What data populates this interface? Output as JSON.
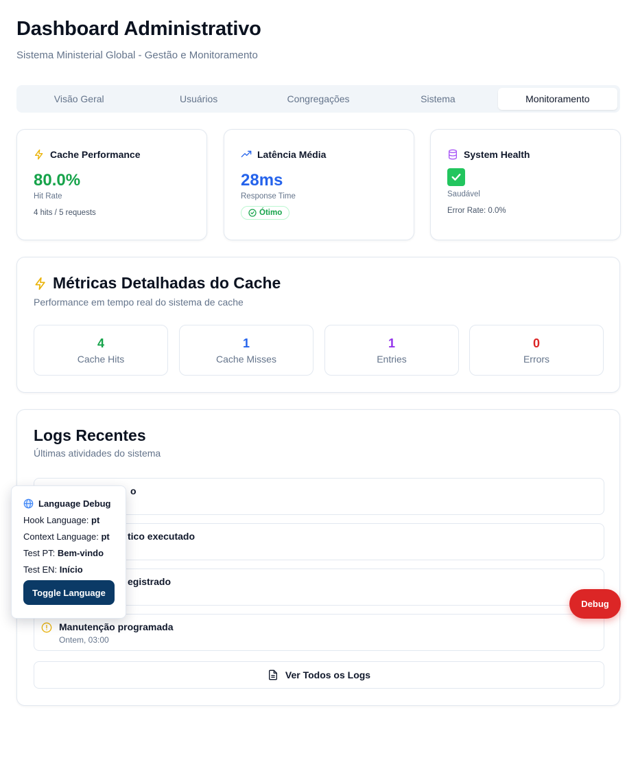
{
  "header": {
    "title": "Dashboard Administrativo",
    "subtitle": "Sistema Ministerial Global - Gestão e Monitoramento"
  },
  "tabs": [
    {
      "label": "Visão Geral",
      "active": false
    },
    {
      "label": "Usuários",
      "active": false
    },
    {
      "label": "Congregações",
      "active": false
    },
    {
      "label": "Sistema",
      "active": false
    },
    {
      "label": "Monitoramento",
      "active": true
    }
  ],
  "stats": {
    "cache": {
      "title": "Cache Performance",
      "icon": "zap-icon",
      "value": "80.0%",
      "label": "Hit Rate",
      "detail": "4 hits / 5 requests",
      "color": "#16a34a"
    },
    "latency": {
      "title": "Latência Média",
      "icon": "trending-up-icon",
      "value": "28ms",
      "label": "Response Time",
      "badge": "Ótimo",
      "color": "#2563eb"
    },
    "health": {
      "title": "System Health",
      "icon": "database-icon",
      "status_icon": "check-mark-icon",
      "label": "Saudável",
      "detail": "Error Rate: 0.0%",
      "color": "#a855f7"
    }
  },
  "cache_metrics": {
    "title": "Métricas Detalhadas do Cache",
    "subtitle": "Performance em tempo real do sistema de cache",
    "items": [
      {
        "value": "4",
        "label": "Cache Hits",
        "color": "#16a34a"
      },
      {
        "value": "1",
        "label": "Cache Misses",
        "color": "#2563eb"
      },
      {
        "value": "1",
        "label": "Entries",
        "color": "#9333ea"
      },
      {
        "value": "0",
        "label": "Errors",
        "color": "#dc2626"
      }
    ]
  },
  "logs": {
    "title": "Logs Recentes",
    "subtitle": "Últimas atividades do sistema",
    "items": [
      {
        "title": "o",
        "time": ""
      },
      {
        "title": "tico executado",
        "time": ""
      },
      {
        "title": "egistrado",
        "time": ""
      },
      {
        "title": "Manutenção programada",
        "time": "Ontem, 03:00",
        "icon": "alert-circle-icon"
      }
    ],
    "view_all": "Ver Todos os Logs"
  },
  "language_debug": {
    "title": "Language Debug",
    "hook_label": "Hook Language: ",
    "hook_value": "pt",
    "context_label": "Context Language: ",
    "context_value": "pt",
    "test_pt_label": "Test PT: ",
    "test_pt_value": "Bem-vindo",
    "test_en_label": "Test EN: ",
    "test_en_value": "Início",
    "toggle": "Toggle Language"
  },
  "debug_button": "Debug"
}
